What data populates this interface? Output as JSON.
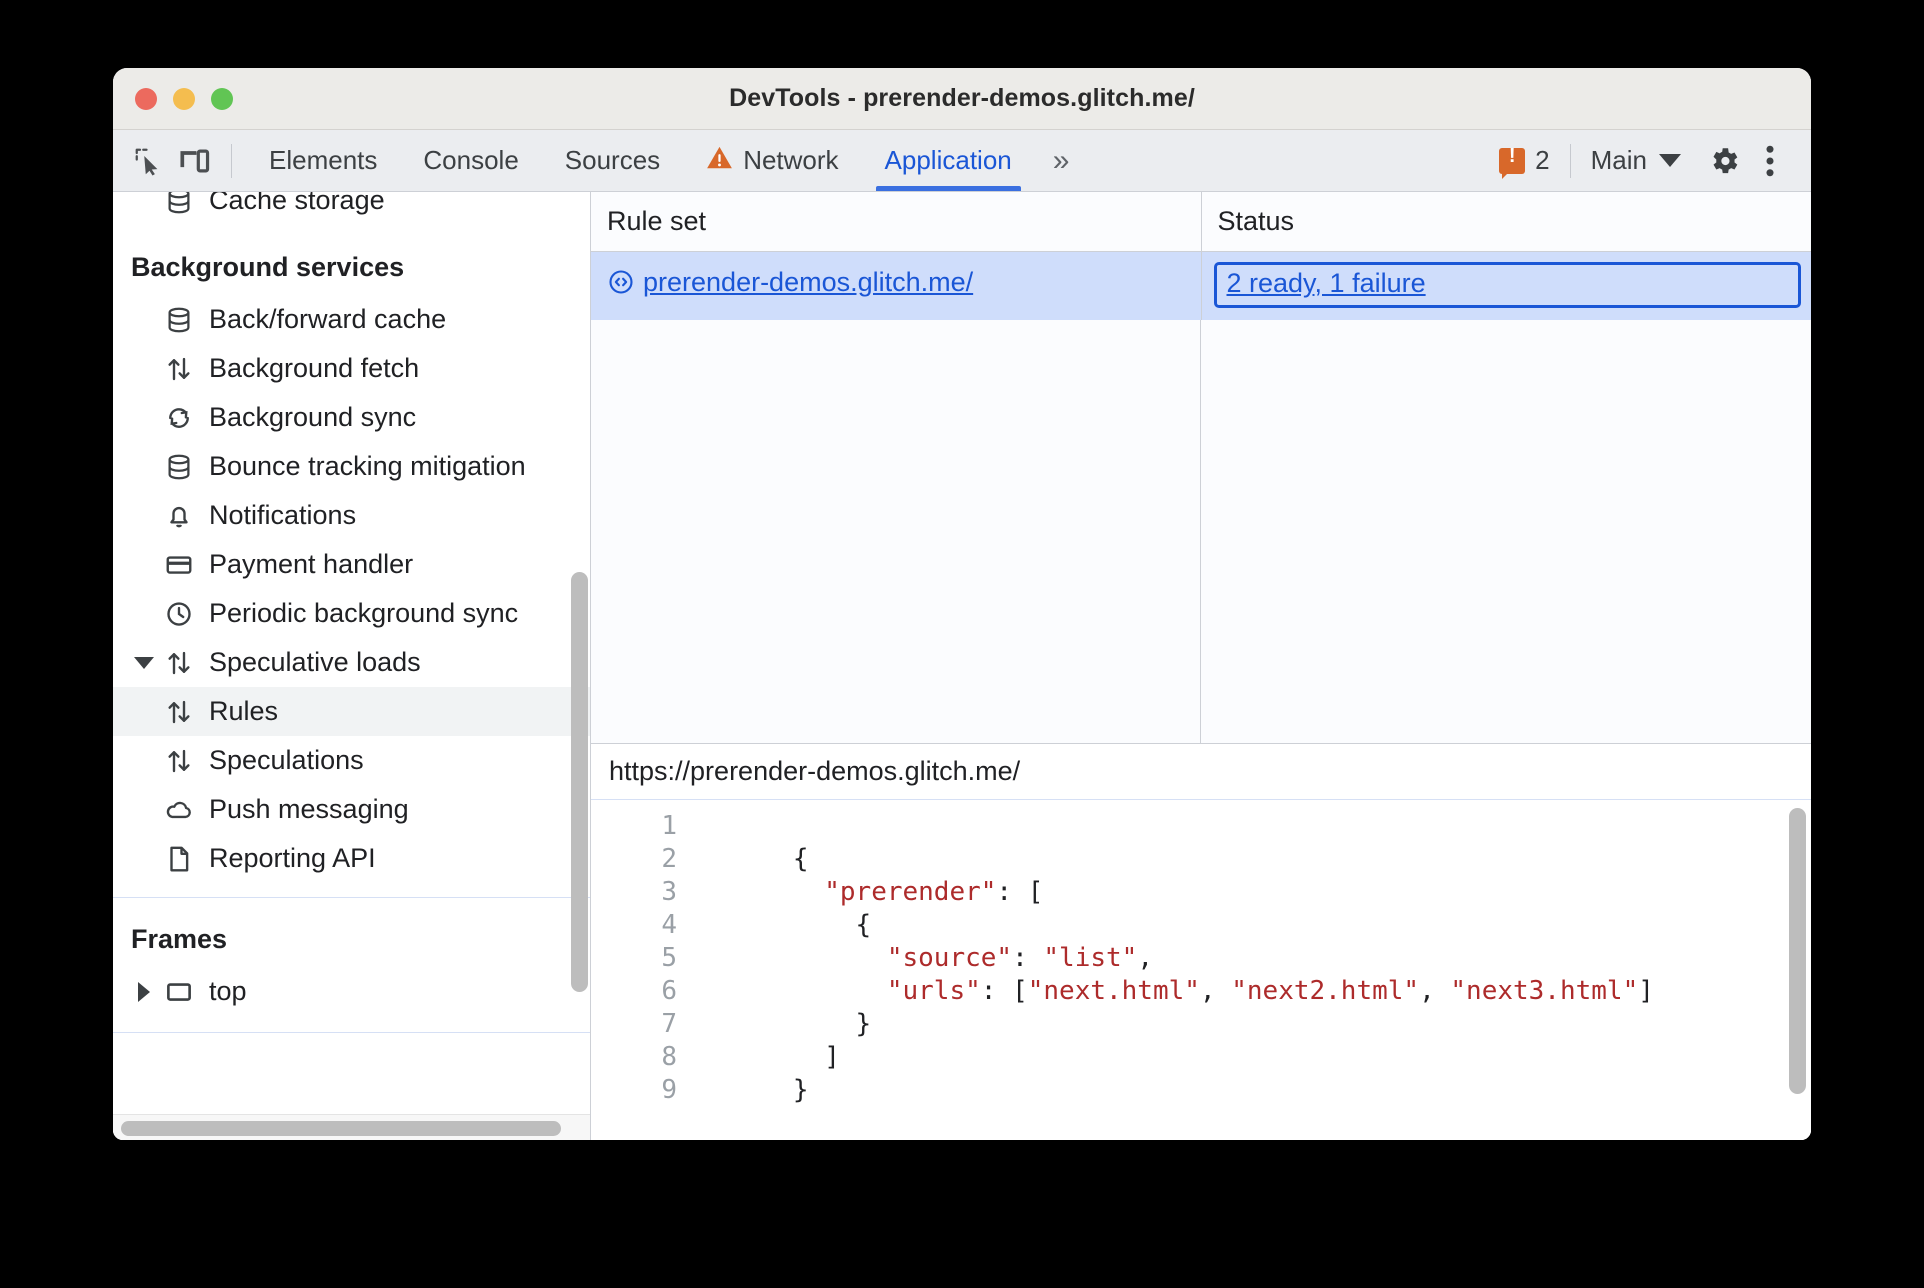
{
  "window": {
    "title": "DevTools - prerender-demos.glitch.me/",
    "traffic_lights": [
      "close",
      "minimize",
      "zoom"
    ],
    "colors": {
      "red": "#ec6a5e",
      "yellow": "#f4bd4f",
      "green": "#61c554"
    }
  },
  "toolbar": {
    "inspect_icon": "inspect-element-icon",
    "device_icon": "device-toolbar-icon",
    "tabs": [
      {
        "label": "Elements",
        "active": false,
        "icon": null
      },
      {
        "label": "Console",
        "active": false,
        "icon": null
      },
      {
        "label": "Sources",
        "active": false,
        "icon": null
      },
      {
        "label": "Network",
        "active": false,
        "icon": "warning-triangle-icon"
      },
      {
        "label": "Application",
        "active": true,
        "icon": null
      }
    ],
    "more_tabs_label": "»",
    "error_count": "2",
    "context_label": "Main",
    "settings_icon": "gear-icon",
    "more_icon": "three-dot-menu-icon",
    "accent_color": "#1a56d6",
    "warning_color": "#d8682a"
  },
  "sidebar": {
    "clipped_top_item": {
      "label": "Cache storage",
      "icon": "database-icon"
    },
    "sections": [
      {
        "title": "Background services",
        "items": [
          {
            "label": "Back/forward cache",
            "icon": "database-icon",
            "indent": 0,
            "twisty": null,
            "selected": false
          },
          {
            "label": "Background fetch",
            "icon": "updown-arrows-icon",
            "indent": 0,
            "twisty": null,
            "selected": false
          },
          {
            "label": "Background sync",
            "icon": "sync-icon",
            "indent": 0,
            "twisty": null,
            "selected": false
          },
          {
            "label": "Bounce tracking mitigation",
            "icon": "database-icon",
            "indent": 0,
            "twisty": null,
            "selected": false
          },
          {
            "label": "Notifications",
            "icon": "bell-icon",
            "indent": 0,
            "twisty": null,
            "selected": false
          },
          {
            "label": "Payment handler",
            "icon": "credit-card-icon",
            "indent": 0,
            "twisty": null,
            "selected": false
          },
          {
            "label": "Periodic background sync",
            "icon": "clock-icon",
            "indent": 0,
            "twisty": null,
            "selected": false
          },
          {
            "label": "Speculative loads",
            "icon": "updown-arrows-icon",
            "indent": 0,
            "twisty": "expanded",
            "selected": false
          },
          {
            "label": "Rules",
            "icon": "updown-arrows-icon",
            "indent": 1,
            "twisty": null,
            "selected": true
          },
          {
            "label": "Speculations",
            "icon": "updown-arrows-icon",
            "indent": 1,
            "twisty": null,
            "selected": false
          },
          {
            "label": "Push messaging",
            "icon": "cloud-icon",
            "indent": 0,
            "twisty": null,
            "selected": false
          },
          {
            "label": "Reporting API",
            "icon": "document-icon",
            "indent": 0,
            "twisty": null,
            "selected": false
          }
        ]
      },
      {
        "title": "Frames",
        "items": [
          {
            "label": "top",
            "icon": "frame-icon",
            "indent": 0,
            "twisty": "collapsed",
            "selected": false
          }
        ]
      }
    ]
  },
  "rules_grid": {
    "columns": [
      "Rule set",
      "Status"
    ],
    "rows": [
      {
        "rule_set": "prerender-demos.glitch.me/",
        "rule_set_icon": "code-brackets-icon",
        "status": "2 ready, 1 failure",
        "selected": true,
        "status_focused": true
      }
    ]
  },
  "details": {
    "url": "https://prerender-demos.glitch.me/",
    "code_lines": [
      {
        "number": "1",
        "segments": []
      },
      {
        "number": "2",
        "segments": [
          {
            "t": "      {",
            "c": "plain"
          }
        ]
      },
      {
        "number": "3",
        "segments": [
          {
            "t": "        ",
            "c": "plain"
          },
          {
            "t": "\"prerender\"",
            "c": "string"
          },
          {
            "t": ": [",
            "c": "plain"
          }
        ]
      },
      {
        "number": "4",
        "segments": [
          {
            "t": "          {",
            "c": "plain"
          }
        ]
      },
      {
        "number": "5",
        "segments": [
          {
            "t": "            ",
            "c": "plain"
          },
          {
            "t": "\"source\"",
            "c": "string"
          },
          {
            "t": ": ",
            "c": "plain"
          },
          {
            "t": "\"list\"",
            "c": "string"
          },
          {
            "t": ",",
            "c": "plain"
          }
        ]
      },
      {
        "number": "6",
        "segments": [
          {
            "t": "            ",
            "c": "plain"
          },
          {
            "t": "\"urls\"",
            "c": "string"
          },
          {
            "t": ": [",
            "c": "plain"
          },
          {
            "t": "\"next.html\"",
            "c": "string"
          },
          {
            "t": ", ",
            "c": "plain"
          },
          {
            "t": "\"next2.html\"",
            "c": "string"
          },
          {
            "t": ", ",
            "c": "plain"
          },
          {
            "t": "\"next3.html\"",
            "c": "string"
          },
          {
            "t": "]",
            "c": "plain"
          }
        ]
      },
      {
        "number": "7",
        "segments": [
          {
            "t": "          }",
            "c": "plain"
          }
        ]
      },
      {
        "number": "8",
        "segments": [
          {
            "t": "        ]",
            "c": "plain"
          }
        ]
      },
      {
        "number": "9",
        "segments": [
          {
            "t": "      }",
            "c": "plain"
          }
        ]
      }
    ],
    "string_color": "#ad2b2b"
  }
}
